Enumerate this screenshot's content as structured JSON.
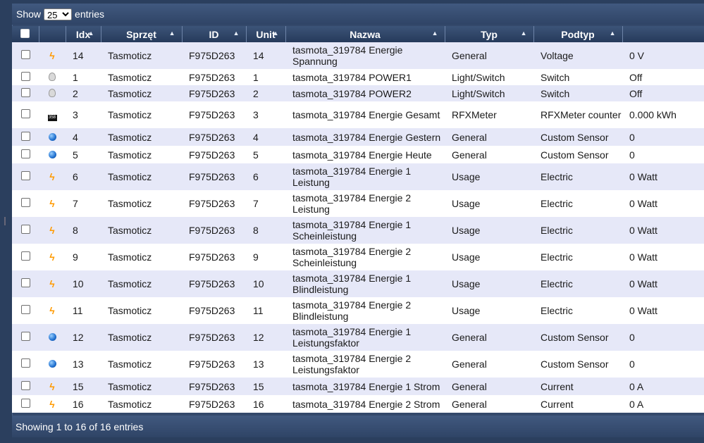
{
  "length_control": {
    "show_label": "Show",
    "value": "25",
    "entries_label": "entries"
  },
  "columns": [
    "",
    "",
    "Idx",
    "Sprzęt",
    "ID",
    "Unit",
    "Nazwa",
    "Typ",
    "Podtyp",
    ""
  ],
  "rows": [
    {
      "icon": "bolt-icon",
      "idx": "14",
      "hw": "Tasmoticz",
      "id": "F975D263",
      "unit": "14",
      "name": "tasmota_319784 Energie Spannung",
      "type": "General",
      "subtype": "Voltage",
      "data": "0 V"
    },
    {
      "icon": "bulb-icon",
      "idx": "1",
      "hw": "Tasmoticz",
      "id": "F975D263",
      "unit": "1",
      "name": "tasmota_319784 POWER1",
      "type": "Light/Switch",
      "subtype": "Switch",
      "data": "Off"
    },
    {
      "icon": "bulb-icon",
      "idx": "2",
      "hw": "Tasmoticz",
      "id": "F975D263",
      "unit": "2",
      "name": "tasmota_319784 POWER2",
      "type": "Light/Switch",
      "subtype": "Switch",
      "data": "Off"
    },
    {
      "icon": "meter-icon",
      "idx": "3",
      "hw": "Tasmoticz",
      "id": "F975D263",
      "unit": "3",
      "name": "tasmota_319784 Energie Gesamt",
      "type": "RFXMeter",
      "subtype": "RFXMeter counter",
      "data": "0.000 kWh"
    },
    {
      "icon": "globe-icon",
      "idx": "4",
      "hw": "Tasmoticz",
      "id": "F975D263",
      "unit": "4",
      "name": "tasmota_319784 Energie Gestern",
      "type": "General",
      "subtype": "Custom Sensor",
      "data": "0"
    },
    {
      "icon": "globe-icon",
      "idx": "5",
      "hw": "Tasmoticz",
      "id": "F975D263",
      "unit": "5",
      "name": "tasmota_319784 Energie Heute",
      "type": "General",
      "subtype": "Custom Sensor",
      "data": "0"
    },
    {
      "icon": "bolt-icon",
      "idx": "6",
      "hw": "Tasmoticz",
      "id": "F975D263",
      "unit": "6",
      "name": "tasmota_319784 Energie 1 Leistung",
      "type": "Usage",
      "subtype": "Electric",
      "data": "0 Watt"
    },
    {
      "icon": "bolt-icon",
      "idx": "7",
      "hw": "Tasmoticz",
      "id": "F975D263",
      "unit": "7",
      "name": "tasmota_319784 Energie 2 Leistung",
      "type": "Usage",
      "subtype": "Electric",
      "data": "0 Watt"
    },
    {
      "icon": "bolt-icon",
      "idx": "8",
      "hw": "Tasmoticz",
      "id": "F975D263",
      "unit": "8",
      "name": "tasmota_319784 Energie 1 Scheinleistung",
      "type": "Usage",
      "subtype": "Electric",
      "data": "0 Watt"
    },
    {
      "icon": "bolt-icon",
      "idx": "9",
      "hw": "Tasmoticz",
      "id": "F975D263",
      "unit": "9",
      "name": "tasmota_319784 Energie 2 Scheinleistung",
      "type": "Usage",
      "subtype": "Electric",
      "data": "0 Watt"
    },
    {
      "icon": "bolt-icon",
      "idx": "10",
      "hw": "Tasmoticz",
      "id": "F975D263",
      "unit": "10",
      "name": "tasmota_319784 Energie 1 Blindleistung",
      "type": "Usage",
      "subtype": "Electric",
      "data": "0 Watt"
    },
    {
      "icon": "bolt-icon",
      "idx": "11",
      "hw": "Tasmoticz",
      "id": "F975D263",
      "unit": "11",
      "name": "tasmota_319784 Energie 2 Blindleistung",
      "type": "Usage",
      "subtype": "Electric",
      "data": "0 Watt"
    },
    {
      "icon": "globe-icon",
      "idx": "12",
      "hw": "Tasmoticz",
      "id": "F975D263",
      "unit": "12",
      "name": "tasmota_319784 Energie 1 Leistungsfaktor",
      "type": "General",
      "subtype": "Custom Sensor",
      "data": "0"
    },
    {
      "icon": "globe-icon",
      "idx": "13",
      "hw": "Tasmoticz",
      "id": "F975D263",
      "unit": "13",
      "name": "tasmota_319784 Energie 2 Leistungsfaktor",
      "type": "General",
      "subtype": "Custom Sensor",
      "data": "0"
    },
    {
      "icon": "bolt-icon",
      "idx": "15",
      "hw": "Tasmoticz",
      "id": "F975D263",
      "unit": "15",
      "name": "tasmota_319784 Energie 1 Strom",
      "type": "General",
      "subtype": "Current",
      "data": "0 A"
    },
    {
      "icon": "bolt-icon",
      "idx": "16",
      "hw": "Tasmoticz",
      "id": "F975D263",
      "unit": "16",
      "name": "tasmota_319784 Energie 2 Strom",
      "type": "General",
      "subtype": "Current",
      "data": "0 A"
    }
  ],
  "footer": {
    "info": "Showing 1 to 16 of 16 entries"
  }
}
